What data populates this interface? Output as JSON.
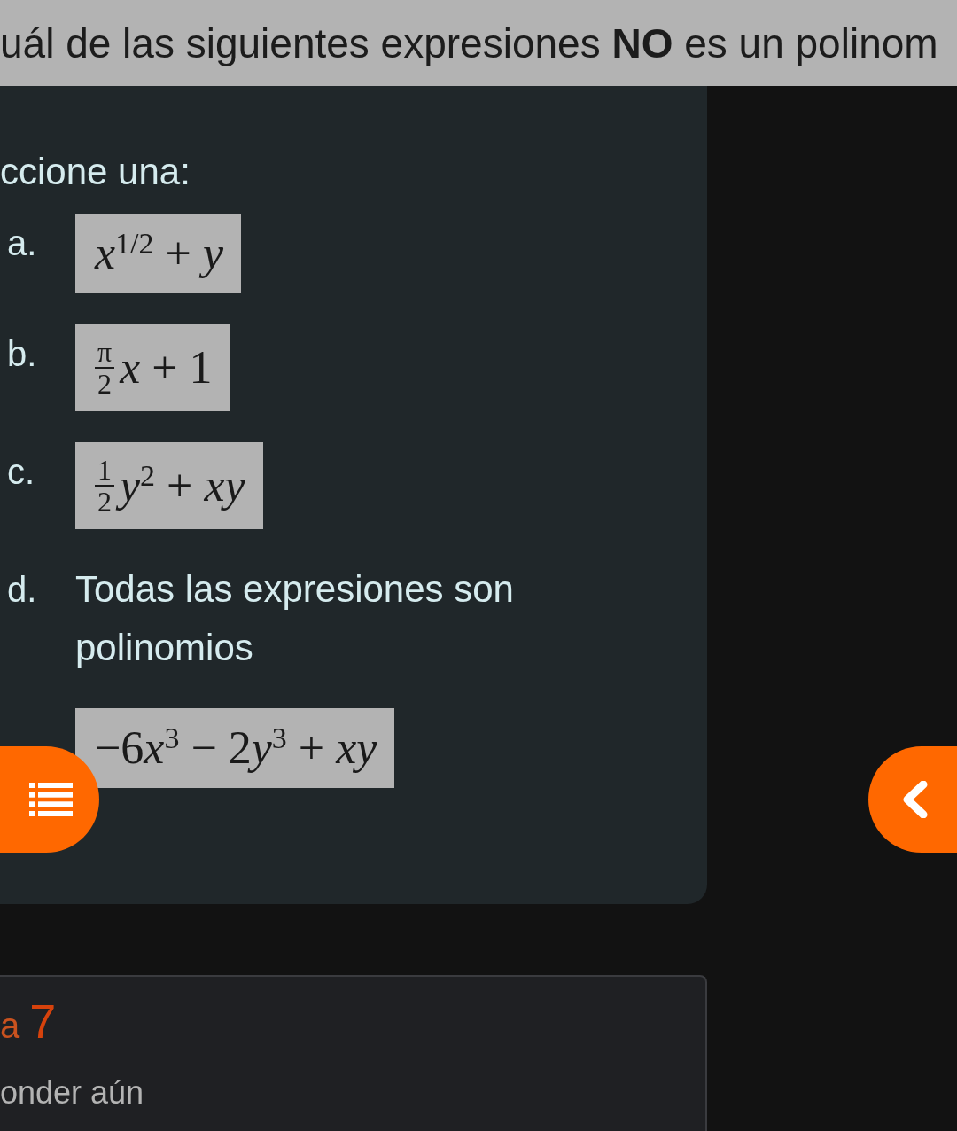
{
  "question_bar": {
    "text": "uál de las siguientes expresiones **NO** es un polinom"
  },
  "prompt": "ccione una:",
  "options": [
    {
      "letter": "a.",
      "kind": "math",
      "parts": [
        {
          "kind": "text",
          "text": "*x*$^{1/2}$ + *y*"
        }
      ]
    },
    {
      "letter": "b.",
      "kind": "math",
      "parts": [
        {
          "kind": "fraction",
          "numerator": "π",
          "denominator": "2"
        },
        {
          "kind": "text",
          "text": "*x* + 1"
        }
      ]
    },
    {
      "letter": "c.",
      "kind": "math",
      "parts": [
        {
          "kind": "fraction",
          "numerator": "1",
          "denominator": "2"
        },
        {
          "kind": "text",
          "text": "*y*$^{2}$ + *xy*"
        }
      ]
    },
    {
      "letter": "d.",
      "kind": "text",
      "text": "Todas las expresiones son polinomios"
    },
    {
      "kind": "math",
      "parts": [
        {
          "kind": "text",
          "text": "−6"
        },
        {
          "kind": "text",
          "text": "*x*$^{3}$ − 2"
        },
        {
          "kind": "text",
          "text": "*y*$^{3}$ + *xy*"
        }
      ]
    }
  ],
  "next_question": {
    "label": "a",
    "number": "7",
    "status": "onder aún"
  }
}
